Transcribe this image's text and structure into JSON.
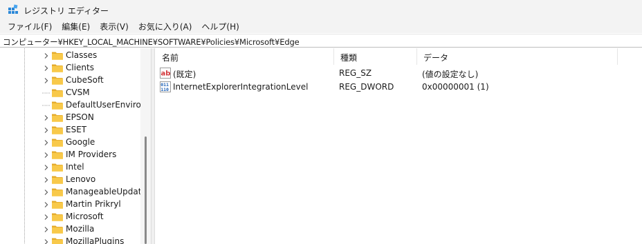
{
  "window": {
    "title": "レジストリ エディター",
    "icon": "registry-editor-icon"
  },
  "menu": [
    {
      "label": "ファイル(F)"
    },
    {
      "label": "編集(E)"
    },
    {
      "label": "表示(V)"
    },
    {
      "label": "お気に入り(A)"
    },
    {
      "label": "ヘルプ(H)"
    }
  ],
  "address": "コンピューター¥HKEY_LOCAL_MACHINE¥SOFTWARE¥Policies¥Microsoft¥Edge",
  "tree": {
    "items": [
      {
        "label": "Classes",
        "has_children": true
      },
      {
        "label": "Clients",
        "has_children": true
      },
      {
        "label": "CubeSoft",
        "has_children": true
      },
      {
        "label": "CVSM",
        "has_children": false
      },
      {
        "label": "DefaultUserEnvironn",
        "has_children": false
      },
      {
        "label": "EPSON",
        "has_children": true
      },
      {
        "label": "ESET",
        "has_children": true
      },
      {
        "label": "Google",
        "has_children": true
      },
      {
        "label": "IM Providers",
        "has_children": true
      },
      {
        "label": "Intel",
        "has_children": true
      },
      {
        "label": "Lenovo",
        "has_children": true
      },
      {
        "label": "ManageableUpdateF",
        "has_children": true
      },
      {
        "label": "Martin Prikryl",
        "has_children": true
      },
      {
        "label": "Microsoft",
        "has_children": true
      },
      {
        "label": "Mozilla",
        "has_children": true
      },
      {
        "label": "MozillaPlugins",
        "has_children": true
      }
    ]
  },
  "list": {
    "columns": {
      "name": "名前",
      "type": "種類",
      "data": "データ"
    },
    "rows": [
      {
        "icon": "string-value-icon",
        "name": "(既定)",
        "type": "REG_SZ",
        "data": "(値の設定なし)"
      },
      {
        "icon": "binary-value-icon",
        "name": "InternetExplorerIntegrationLevel",
        "type": "REG_DWORD",
        "data": "0x00000001 (1)"
      }
    ]
  },
  "colors": {
    "chrome_bg": "#f3f3f3",
    "folder": "#f8c94a",
    "folder_dark": "#e3a92a",
    "string_icon_red": "#d13438",
    "binary_icon_blue": "#1b5fb5"
  }
}
